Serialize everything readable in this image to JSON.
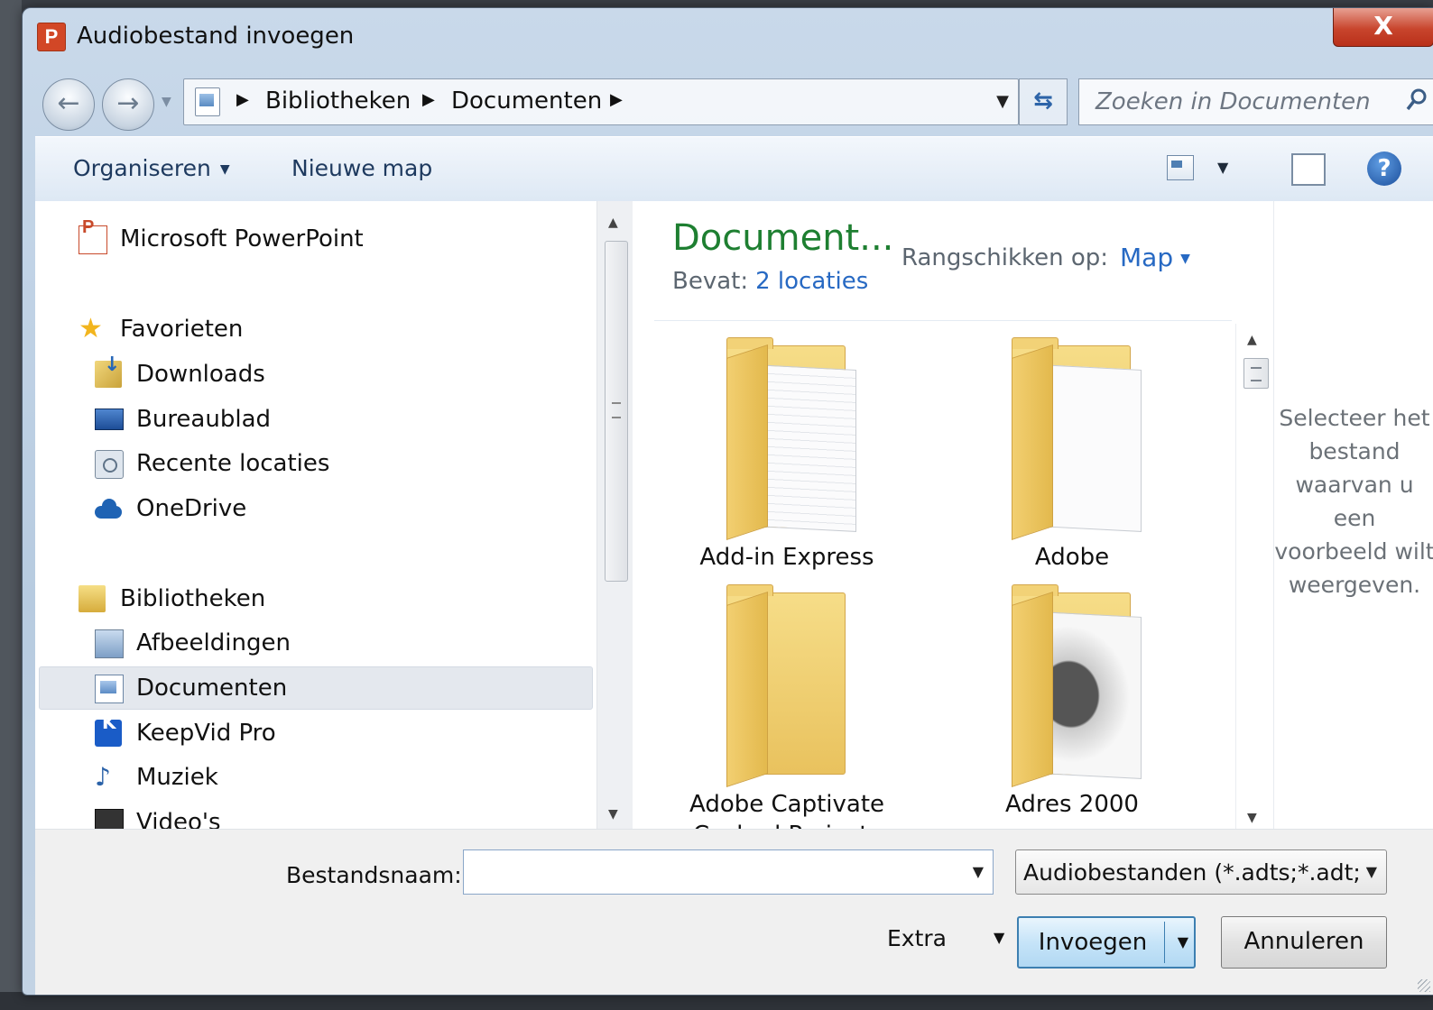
{
  "window": {
    "title": "Audiobestand invoegen",
    "close_label": "X",
    "app_icon_letter": "P"
  },
  "navbar": {
    "back_icon": "←",
    "forward_icon": "→",
    "breadcrumbs": [
      "Bibliotheken",
      "Documenten"
    ],
    "search_placeholder": "Zoeken in Documenten"
  },
  "toolbar": {
    "organize_label": "Organiseren",
    "new_folder_label": "Nieuwe map",
    "help_label": "?"
  },
  "sidebar": {
    "items": [
      {
        "label": "Microsoft PowerPoint",
        "icon": "powerpoint-icon"
      },
      {
        "label": "Favorieten",
        "icon": "star-icon"
      },
      {
        "label": "Downloads",
        "icon": "downloads-icon"
      },
      {
        "label": "Bureaublad",
        "icon": "desktop-icon"
      },
      {
        "label": "Recente locaties",
        "icon": "recent-places-icon"
      },
      {
        "label": "OneDrive",
        "icon": "onedrive-icon"
      },
      {
        "label": "Bibliotheken",
        "icon": "libraries-icon"
      },
      {
        "label": "Afbeeldingen",
        "icon": "pictures-icon"
      },
      {
        "label": "Documenten",
        "icon": "documents-icon"
      },
      {
        "label": "KeepVid Pro",
        "icon": "keepvid-icon"
      },
      {
        "label": "Muziek",
        "icon": "music-icon"
      },
      {
        "label": "Video's",
        "icon": "video-icon"
      }
    ],
    "selected": "Documenten"
  },
  "library": {
    "title": "Document...",
    "contains_label": "Bevat:",
    "contains_link": "2 locaties",
    "arrange_label": "Rangschikken op:",
    "arrange_value": "Map"
  },
  "files": [
    {
      "name": "Add-in Express",
      "icon": "folder-icon"
    },
    {
      "name": "Adobe",
      "icon": "folder-icon"
    },
    {
      "name": "Adobe Captivate Cached Projects",
      "icon": "folder-icon"
    },
    {
      "name": "Adres 2000",
      "icon": "folder-icon"
    }
  ],
  "preview": {
    "message": "Selecteer het bestand waarvan u een voorbeeld wilt weergeven."
  },
  "footer": {
    "filename_label": "Bestandsnaam:",
    "filename_value": "",
    "filetype_value": "Audiobestanden (*.adts;*.adt;",
    "extra_label": "Extra",
    "insert_label": "Invoegen",
    "cancel_label": "Annuleren"
  }
}
